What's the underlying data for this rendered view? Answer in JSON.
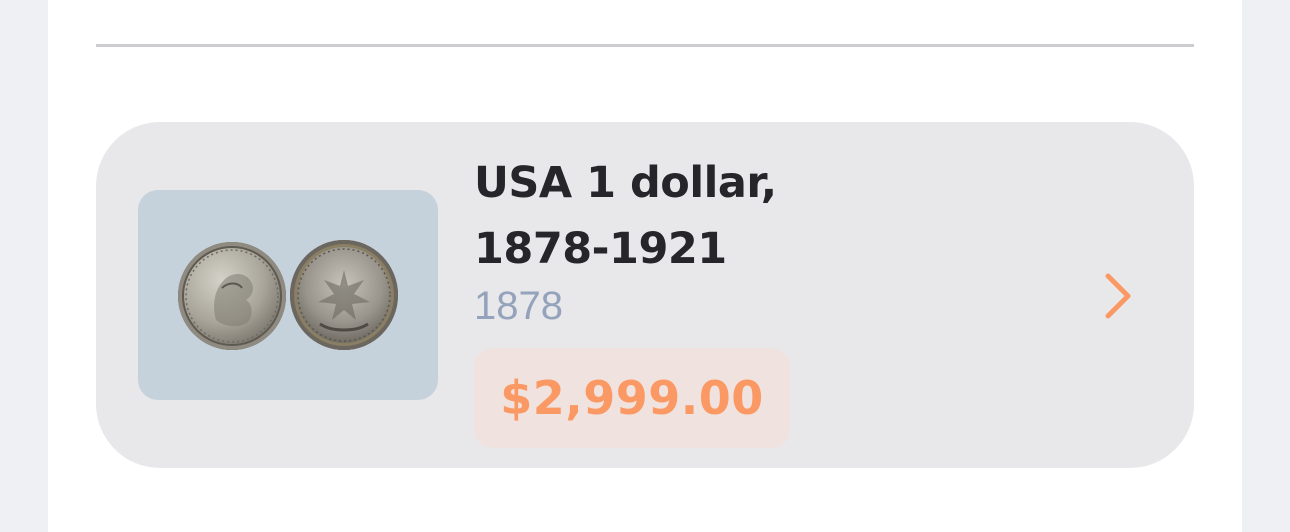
{
  "listing": {
    "title_line1": "USA 1 dollar,",
    "title_line2": "1878-1921",
    "year": "1878",
    "price": "$2,999.00"
  },
  "colors": {
    "accent": "#fb9965",
    "card_background": "#e8e8eb",
    "price_badge_background": "#f0e2de",
    "year_text": "#94a3bb",
    "title_text": "#26262a"
  },
  "icons": {
    "detail": "chevron-right-icon"
  }
}
